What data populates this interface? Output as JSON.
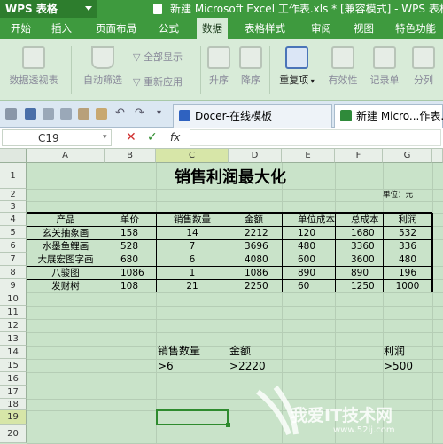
{
  "app": {
    "logo": "WPS 表格",
    "window_title": "新建 Microsoft Excel 工作表.xls * [兼容模式] - WPS 表格"
  },
  "menu": [
    "开始",
    "插入",
    "页面布局",
    "公式",
    "数据",
    "表格样式",
    "审阅",
    "视图",
    "特色功能"
  ],
  "active_menu": "数据",
  "ribbon": {
    "pivot": "数据透视表",
    "autofilter": "自动筛选",
    "show_all": "全部显示",
    "reapply": "重新应用",
    "sort_asc": "升序",
    "sort_desc": "降序",
    "duplicates": "重复项",
    "validity": "有效性",
    "record": "记录单",
    "split": "分列"
  },
  "tabs": [
    {
      "label": "Docer-在线模板"
    },
    {
      "label": "新建 Micro...作表.xls"
    }
  ],
  "formula_bar": {
    "cell_ref": "C19",
    "fx": "fx",
    "cancel": "✕",
    "confirm": "✓"
  },
  "columns": [
    "A",
    "B",
    "C",
    "D",
    "E",
    "F",
    "G"
  ],
  "rows": [
    "1",
    "2",
    "3",
    "4",
    "5",
    "6",
    "7",
    "8",
    "9",
    "10",
    "11",
    "12",
    "13",
    "14",
    "15",
    "16",
    "17",
    "18",
    "19",
    "20"
  ],
  "sheet": {
    "title": "销售利润最大化",
    "unit": "单位：元",
    "headers": [
      "产品",
      "单价",
      "销售数量",
      "金额",
      "单位成本",
      "总成本",
      "利润"
    ],
    "data": [
      [
        "玄关抽象画",
        "158",
        "14",
        "2212",
        "120",
        "1680",
        "532"
      ],
      [
        "水墨鱼鲤画",
        "528",
        "7",
        "3696",
        "480",
        "3360",
        "336"
      ],
      [
        "大展宏图字画",
        "680",
        "6",
        "4080",
        "600",
        "3600",
        "480"
      ],
      [
        "八骏图",
        "1086",
        "1",
        "1086",
        "890",
        "890",
        "196"
      ],
      [
        "发财树",
        "108",
        "21",
        "2250",
        "60",
        "1250",
        "1000"
      ]
    ],
    "cond_labels": [
      "销售数量",
      "金额",
      "利润"
    ],
    "cond_values": [
      ">6",
      ">2220",
      ">500"
    ]
  },
  "watermark": {
    "text": "我爱IT技术网",
    "url": "www.52ij.com"
  },
  "colors": {
    "accent": "#3e9a3e",
    "sheet_bg": "#c9e3c9",
    "selection": "#2e8b2e"
  }
}
